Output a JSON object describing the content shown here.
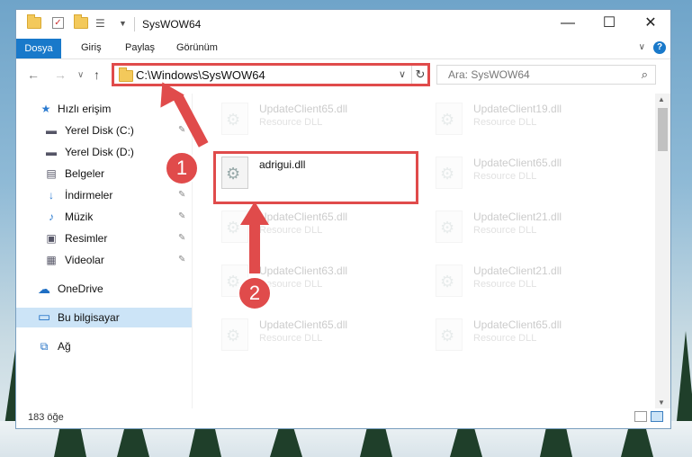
{
  "window": {
    "title": "SysWOW64",
    "minimize_label": "—",
    "maximize_label": "☐",
    "close_label": "✕"
  },
  "ribbon": {
    "tabs": [
      "Dosya",
      "Giriş",
      "Paylaş",
      "Görünüm"
    ],
    "help_label": "?",
    "collapse_label": "∨"
  },
  "navigation": {
    "back": "←",
    "forward": "→",
    "recent": "∨",
    "up": "↑",
    "address": "C:\\Windows\\SysWOW64",
    "refresh": "↻",
    "search_placeholder": "Ara: SysWOW64",
    "search_icon": "⌕"
  },
  "sidebar": {
    "items": [
      {
        "label": "Hızlı erişim",
        "icon": "star-icon",
        "glyph": "★",
        "color": "#2b7bd0"
      },
      {
        "label": "Yerel Disk (C:)",
        "icon": "drive-icon",
        "glyph": "▬",
        "color": "#556"
      },
      {
        "label": "Yerel Disk (D:)",
        "icon": "drive-icon",
        "glyph": "▬",
        "color": "#556"
      },
      {
        "label": "Belgeler",
        "icon": "documents-icon",
        "glyph": "▤",
        "color": "#556"
      },
      {
        "label": "İndirmeler",
        "icon": "download-icon",
        "glyph": "↓",
        "color": "#2b7bd0"
      },
      {
        "label": "Müzik",
        "icon": "music-icon",
        "glyph": "♪",
        "color": "#2b7bd0"
      },
      {
        "label": "Resimler",
        "icon": "pictures-icon",
        "glyph": "▣",
        "color": "#556"
      },
      {
        "label": "Videolar",
        "icon": "videos-icon",
        "glyph": "▦",
        "color": "#556"
      },
      {
        "label": "OneDrive",
        "icon": "cloud-icon",
        "glyph": "☁",
        "color": "#1f6fc4"
      },
      {
        "label": "Bu bilgisayar",
        "icon": "computer-icon",
        "glyph": "▭",
        "color": "#1f6fc4"
      },
      {
        "label": "Ağ",
        "icon": "network-icon",
        "glyph": "⧉",
        "color": "#1f6fc4"
      }
    ],
    "pin_glyph": "📌"
  },
  "files": {
    "highlighted": {
      "name": "adrigui.dll"
    },
    "background": [
      {
        "name": "UpdateClient65.dll",
        "type": "Resource DLL"
      },
      {
        "name": "UpdateClient19.dll",
        "type": "Resource DLL"
      },
      {
        "name": "UpdateClient65.dll",
        "type": "Resource DLL"
      },
      {
        "name": "UpdateClient65.dll",
        "type": "Resource DLL"
      },
      {
        "name": "UpdateClient21.dll",
        "type": "Resource DLL"
      },
      {
        "name": "UpdateClient63.dll",
        "type": "Resource DLL"
      },
      {
        "name": "UpdateClient21.dll",
        "type": "Resource DLL"
      },
      {
        "name": "UpdateClient65.dll",
        "type": "Resource DLL"
      },
      {
        "name": "UpdateClient65.dll",
        "type": "Resource DLL"
      }
    ]
  },
  "status": {
    "item_count": "183 öğe"
  },
  "annotations": {
    "step1": "1",
    "step2": "2"
  },
  "colors": {
    "accent": "#1979ca",
    "highlight": "#e04b4b",
    "selection": "#cce4f7"
  }
}
